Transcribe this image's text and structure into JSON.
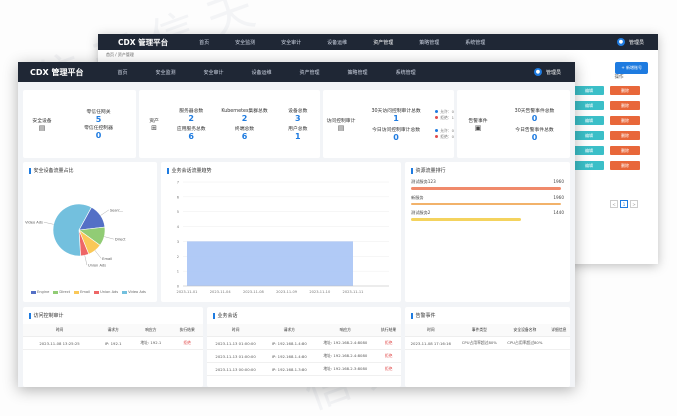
{
  "app_title": "CDX 管理平台",
  "nav": [
    "首页",
    "安全监测",
    "安全审计",
    "设备运维",
    "资产管理",
    "策略管理",
    "系统管理"
  ],
  "user": {
    "name": "管理员",
    "icon": "user-icon"
  },
  "breadcrumb": "首页 / 资产管理",
  "back_window": {
    "add_button": "+ 新增账号",
    "ops_header": "操作",
    "ops_rows": [
      [
        "编辑",
        "删除"
      ],
      [
        "编辑",
        "删除"
      ],
      [
        "编辑",
        "删除"
      ],
      [
        "编辑",
        "删除"
      ],
      [
        "编辑",
        "删除"
      ],
      [
        "编辑",
        "删除"
      ]
    ],
    "pager": [
      "<",
      "1",
      ">"
    ]
  },
  "stats": {
    "security_devices": {
      "label": "安全设备",
      "icon": "document-icon",
      "gateway_label": "零信任网关",
      "gateway_value": "5",
      "controller_label": "零信任控制器",
      "controller_value": "0"
    },
    "assets": {
      "label": "资产",
      "icon": "grid-icon",
      "items": [
        {
          "label": "服务器总数",
          "value": "2"
        },
        {
          "label": "Kubernetes集群总数",
          "value": "2"
        },
        {
          "label": "设备总数",
          "value": "3"
        },
        {
          "label": "应用服务总数",
          "value": "6"
        },
        {
          "label": "终端总数",
          "value": "6"
        },
        {
          "label": "用户总数",
          "value": "1"
        }
      ]
    },
    "audit": {
      "label": "访问控制审计",
      "icon": "doc-list-icon",
      "top_label": "30天访问控制审计总数",
      "top_value": "1",
      "top_allow": "允许：0",
      "top_deny": "拒绝：1",
      "bottom_label": "今日访问控制审计总数",
      "bottom_value": "0",
      "bottom_allow": "允许：0",
      "bottom_deny": "拒绝：0"
    },
    "alerts": {
      "label": "告警事件",
      "icon": "alert-doc-icon",
      "top_label": "30天告警事件总数",
      "top_value": "0",
      "bottom_label": "今日告警事件总数",
      "bottom_value": "0"
    }
  },
  "panels": {
    "pie_title": "安全设备流量占比",
    "line_title": "业务会话流量趋势",
    "rank_title": "资源流量排行",
    "access_title": "访问控制审计",
    "session_title": "业务会话",
    "alert_title": "告警事件"
  },
  "pie": {
    "labels": [
      "Engine",
      "Direct",
      "Email",
      "Union Ads",
      "Video Ads",
      "Search"
    ],
    "legend": [
      "Engine",
      "Direct",
      "Email",
      "Union Ads",
      "Video Ads"
    ],
    "values": [
      335,
      310,
      234,
      135,
      1548,
      400
    ]
  },
  "colors": {
    "blue": "#5470c6",
    "green": "#91cc75",
    "yellow": "#fac858",
    "red": "#ee6666",
    "cyan": "#73c0de",
    "accent": "#1e7be0",
    "teal": "#3bbfc8",
    "orange": "#e8673a"
  },
  "chart_data": {
    "type": "area",
    "x": [
      "2023-11-01",
      "2023-11-04",
      "2023-11-08",
      "2023-11-09",
      "2023-11-10",
      "2023-11-11"
    ],
    "y_ticks": [
      "0",
      "1",
      "2",
      "3",
      "4",
      "5",
      "6",
      "7"
    ],
    "series": [
      {
        "values": [
          3,
          3,
          3,
          3,
          3,
          3
        ]
      }
    ],
    "ylim": [
      0,
      7
    ]
  },
  "ranking": [
    {
      "name": "测试服务123",
      "value": "1960",
      "color": "#f08a6b"
    },
    {
      "name": "新服务",
      "value": "1960",
      "color": "#f2b26a"
    },
    {
      "name": "测试服务2",
      "value": "1440",
      "color": "#f4d35e"
    }
  ],
  "access_table": {
    "headers": [
      "时间",
      "请求方",
      "响应方",
      "执行结果"
    ],
    "rows": [
      [
        "2023-11-08 13:25:25",
        "IP: 192.1",
        "地址: 192.1",
        "拒绝"
      ]
    ]
  },
  "session_table": {
    "headers": [
      "时间",
      "请求方",
      "响应方",
      "执行结果"
    ],
    "rows": [
      [
        "2023-11-13 01:00:00",
        "IP: 192.168.1.4:80",
        "地址: 192.168.2.4:8080",
        "拒绝"
      ],
      [
        "2023-11-13 01:00:00",
        "IP: 192.168.1.4:80",
        "地址: 192.168.2.4:8080",
        "拒绝"
      ],
      [
        "2023-11-13 00:00:00",
        "IP: 192.168.1.3:80",
        "地址: 192.168.2.3:8080",
        "拒绝"
      ]
    ]
  },
  "alert_table": {
    "headers": [
      "时间",
      "事件类型",
      "安全设备名称",
      "详细信息"
    ],
    "rows": [
      [
        "2023-11-08 17:16:16",
        "CPU占用率超过80%",
        "CPU占用率超过80%",
        ""
      ]
    ]
  }
}
